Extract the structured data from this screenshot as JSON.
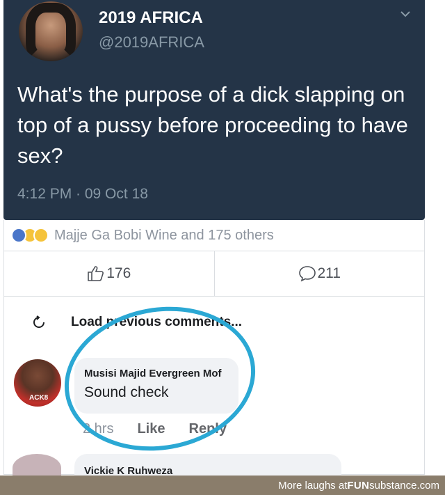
{
  "tweet": {
    "display_name": "2019 AFRICA",
    "handle": "@2019AFRICA",
    "text": "What's the purpose of a dick slapping on top of a pussy before proceeding to have sex?",
    "timestamp": "4:12 PM · 09 Oct 18"
  },
  "facebook": {
    "reactions_text": "Majje Ga Bobi Wine and 175 others",
    "like_count": "176",
    "comment_count": "211",
    "load_previous": "Load previous comments..."
  },
  "comment": {
    "author": "Musisi Majid Evergreen Mof",
    "text": "Sound check",
    "avatar_text": "ACK8",
    "time": "2 hrs",
    "like_label": "Like",
    "reply_label": "Reply"
  },
  "next_comment": {
    "author": "Vickie K Ruhweza"
  },
  "footer": {
    "prefix": "More laughs at ",
    "brand_bold": "FUN",
    "brand_rest": "substance.com"
  },
  "colors": {
    "tweet_bg": "#243447",
    "highlight_circle": "#2ba8d4",
    "footer_bg": "#8a7d6b"
  },
  "icons": [
    "chevron-down-icon",
    "thumbs-up-icon",
    "comment-icon",
    "refresh-icon",
    "like-reaction-icon",
    "haha-reaction-icon",
    "wow-reaction-icon"
  ]
}
